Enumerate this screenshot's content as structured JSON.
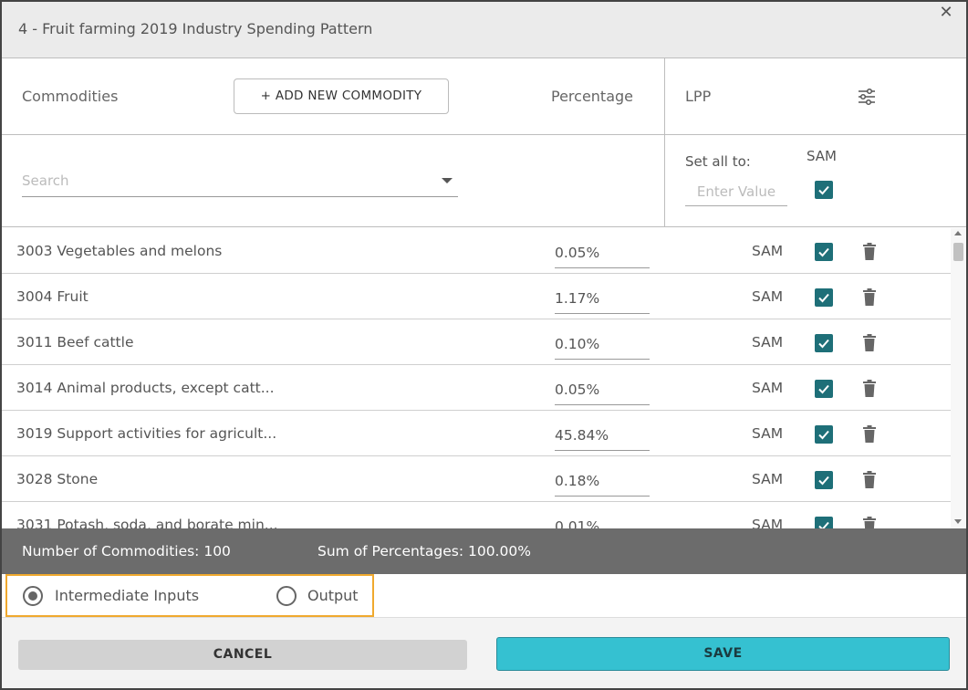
{
  "dialog": {
    "title": "4 - Fruit farming 2019 Industry Spending Pattern",
    "close_icon": "close-icon"
  },
  "header": {
    "commodities_label": "Commodities",
    "add_button_label": "+ ADD NEW COMMODITY",
    "percentage_label": "Percentage",
    "lpp_label": "LPP",
    "filter_icon": "filter-sliders-icon"
  },
  "search": {
    "placeholder": "Search"
  },
  "set_all": {
    "label": "Set all to:",
    "placeholder": "Enter Value",
    "sam_label": "SAM",
    "sam_checked": true
  },
  "rows": [
    {
      "name": "3003 Vegetables and melons",
      "percentage": "0.05%",
      "lpp": "SAM",
      "checked": true
    },
    {
      "name": "3004 Fruit",
      "percentage": "1.17%",
      "lpp": "SAM",
      "checked": true
    },
    {
      "name": "3011 Beef cattle",
      "percentage": "0.10%",
      "lpp": "SAM",
      "checked": true
    },
    {
      "name": "3014 Animal products, except catt...",
      "percentage": "0.05%",
      "lpp": "SAM",
      "checked": true
    },
    {
      "name": "3019 Support activities for agricult...",
      "percentage": "45.84%",
      "lpp": "SAM",
      "checked": true
    },
    {
      "name": "3028 Stone",
      "percentage": "0.18%",
      "lpp": "SAM",
      "checked": true
    },
    {
      "name": "3031 Potash, soda, and borate min...",
      "percentage": "0.01%",
      "lpp": "SAM",
      "checked": true
    }
  ],
  "summary": {
    "count_text": "Number of Commodities: 100",
    "sum_text": "Sum of Percentages: 100.00%"
  },
  "mode": {
    "intermediate_label": "Intermediate Inputs",
    "output_label": "Output",
    "selected": "intermediate"
  },
  "footer": {
    "cancel_label": "CANCEL",
    "save_label": "SAVE"
  },
  "colors": {
    "checkbox": "#1e6f78",
    "save_button": "#35c1d1",
    "summary_bar": "#6c6c6c",
    "highlight_border": "#f0a92e"
  }
}
